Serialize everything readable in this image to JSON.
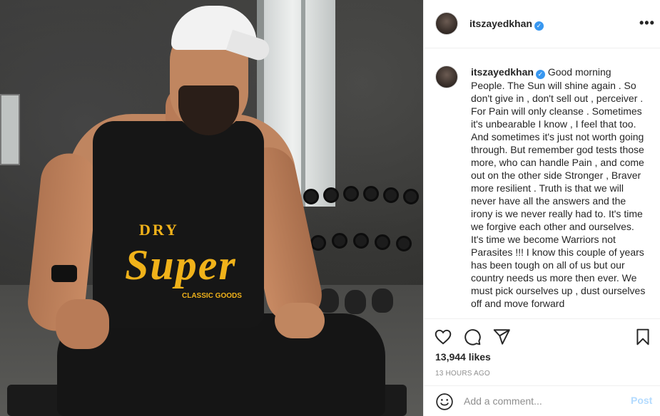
{
  "post": {
    "username": "itszayedkhan",
    "verified_mark": "✓",
    "more_glyph": "•••",
    "photo_print": {
      "line1": "DRY",
      "line2": "Super",
      "line3": "CLASSIC GOODS"
    }
  },
  "caption": {
    "username": "itszayedkhan",
    "text": "Good morning People. The Sun will shine again . So don't give in , don't sell out , perceiver . For Pain will only cleanse . Sometimes it's unbearable I know , I feel that too. And sometimes it's just not worth going through. But remember god tests those more, who can handle Pain , and come out on the other side Stronger , Braver more resilient . Truth is that we will never have all the answers and the irony is we never really had to. It's time we forgive each other and ourselves. It's time we become Warriors not Parasites !!! I know this couple of years has been tough on all of us but our country needs us more then ever. We must pick ourselves up , dust ourselves off and move forward"
  },
  "actions": {
    "icons": [
      "heart-icon",
      "comment-icon",
      "share-icon",
      "bookmark-icon"
    ]
  },
  "likes": "13,944 likes",
  "timestamp": "13 HOURS AGO",
  "comment": {
    "placeholder": "Add a comment...",
    "post_label": "Post",
    "emoji_icon": "smiley-icon"
  },
  "colors": {
    "verified": "#3897f0",
    "post_disabled": "#b3dbff",
    "muted": "#8e8e8e",
    "border": "#efefef"
  }
}
